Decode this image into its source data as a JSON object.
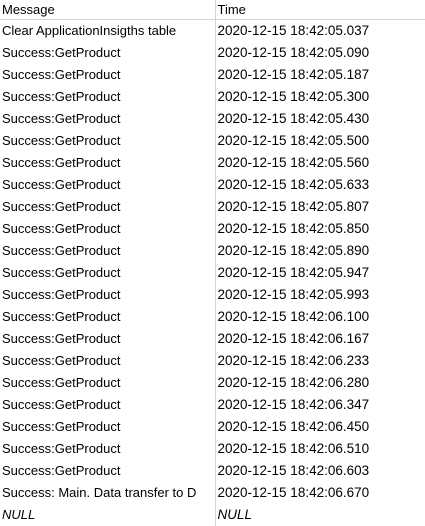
{
  "columns": {
    "message": "Message",
    "time": "Time"
  },
  "rows": [
    {
      "message": "Clear ApplicationInsigths table",
      "time": "2020-12-15 18:42:05.037"
    },
    {
      "message": "Success:GetProduct",
      "time": "2020-12-15 18:42:05.090"
    },
    {
      "message": "Success:GetProduct",
      "time": "2020-12-15 18:42:05.187"
    },
    {
      "message": "Success:GetProduct",
      "time": "2020-12-15 18:42:05.300"
    },
    {
      "message": "Success:GetProduct",
      "time": "2020-12-15 18:42:05.430"
    },
    {
      "message": "Success:GetProduct",
      "time": "2020-12-15 18:42:05.500"
    },
    {
      "message": "Success:GetProduct",
      "time": "2020-12-15 18:42:05.560"
    },
    {
      "message": "Success:GetProduct",
      "time": "2020-12-15 18:42:05.633"
    },
    {
      "message": "Success:GetProduct",
      "time": "2020-12-15 18:42:05.807"
    },
    {
      "message": "Success:GetProduct",
      "time": "2020-12-15 18:42:05.850"
    },
    {
      "message": "Success:GetProduct",
      "time": "2020-12-15 18:42:05.890"
    },
    {
      "message": "Success:GetProduct",
      "time": "2020-12-15 18:42:05.947"
    },
    {
      "message": "Success:GetProduct",
      "time": "2020-12-15 18:42:05.993"
    },
    {
      "message": "Success:GetProduct",
      "time": "2020-12-15 18:42:06.100"
    },
    {
      "message": "Success:GetProduct",
      "time": "2020-12-15 18:42:06.167"
    },
    {
      "message": "Success:GetProduct",
      "time": "2020-12-15 18:42:06.233"
    },
    {
      "message": "Success:GetProduct",
      "time": "2020-12-15 18:42:06.280"
    },
    {
      "message": "Success:GetProduct",
      "time": "2020-12-15 18:42:06.347"
    },
    {
      "message": "Success:GetProduct",
      "time": "2020-12-15 18:42:06.450"
    },
    {
      "message": "Success:GetProduct",
      "time": "2020-12-15 18:42:06.510"
    },
    {
      "message": "Success:GetProduct",
      "time": "2020-12-15 18:42:06.603"
    },
    {
      "message": "Success: Main. Data transfer to D",
      "time": "2020-12-15 18:42:06.670"
    },
    {
      "message": "NULL",
      "time": "NULL"
    }
  ]
}
